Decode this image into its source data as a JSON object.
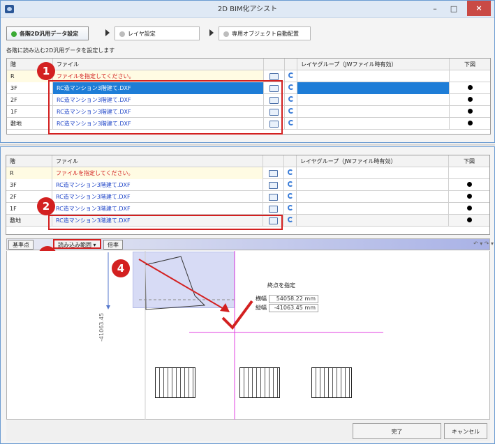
{
  "window": {
    "title": "2D BIM化アシスト",
    "minimize": "–",
    "maximize": "□",
    "close": "×"
  },
  "steps": [
    {
      "label": "各階2D汎用データ設定",
      "active": true
    },
    {
      "label": "レイヤ設定",
      "active": false
    },
    {
      "label": "専用オブジェクト自動配置",
      "active": false
    }
  ],
  "hint": "各階に読み込む2D汎用データを設定します",
  "table": {
    "headers": {
      "floor": "階",
      "file": "ファイル",
      "layer": "レイヤグループ（JWファイル時有効）",
      "underlay": "下図"
    },
    "rows": [
      {
        "floor": "R",
        "file": "ファイルを指定してください。"
      },
      {
        "floor": "3F",
        "file": "RC造マンション3階建て.DXF"
      },
      {
        "floor": "2F",
        "file": "RC造マンション3階建て.DXF"
      },
      {
        "floor": "1F",
        "file": "RC造マンション3階建て.DXF"
      },
      {
        "floor": "敷地",
        "file": "RC造マンション3階建て.DXF"
      }
    ]
  },
  "bottom_table_rows": [
    {
      "floor": "R",
      "file": "ファイルを指定してください。"
    },
    {
      "floor": "3F",
      "file": "RC造マンション3階建て.DXF"
    },
    {
      "floor": "2F",
      "file": "RC造マンション3階建て.DXF"
    },
    {
      "floor": "1F",
      "file": "RC造マンション3階建て.DXF"
    },
    {
      "floor": "敷地",
      "file": "RC造マンション3階建て.DXF"
    }
  ],
  "toolbar": {
    "base_label": "基準点",
    "range_label": "読み込み範囲",
    "scale_label": "倍率"
  },
  "canvas": {
    "prompt": "終点を指定",
    "width_label": "横幅",
    "width_value": "54058.22",
    "height_label": "縦幅",
    "height_value": "-41063.45",
    "unit": "mm",
    "dim_label": "-41063.45"
  },
  "footer": {
    "ok": "完了",
    "cancel": "キャンセル"
  },
  "callouts": [
    "1",
    "2",
    "3",
    "4"
  ],
  "colors": {
    "accent_red": "#d32020",
    "selection_blue": "#1e7dd7",
    "active_dot": "#3aaa35"
  }
}
